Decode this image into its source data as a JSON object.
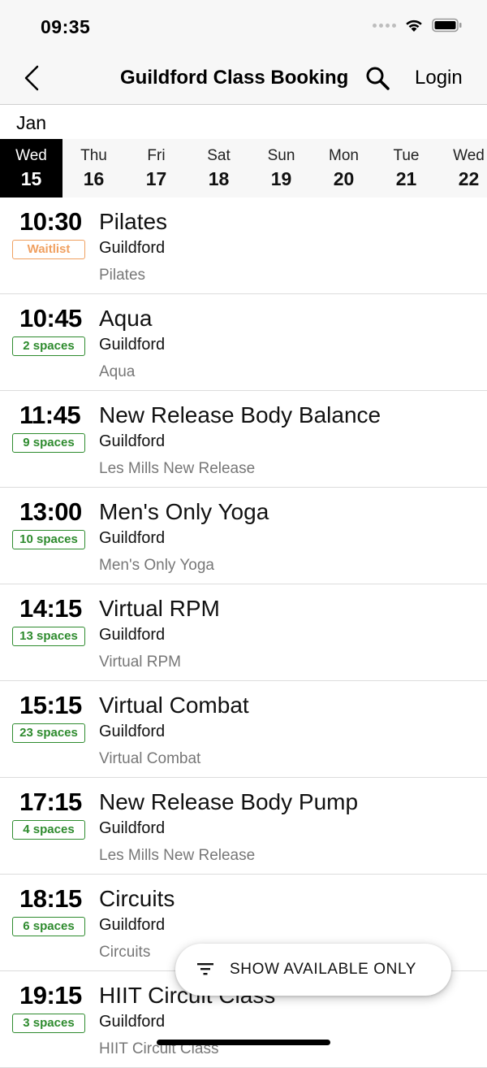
{
  "status_bar": {
    "time": "09:35"
  },
  "nav": {
    "title": "Guildford Class Booking",
    "login_label": "Login"
  },
  "month": "Jan",
  "days": [
    {
      "dow": "Wed",
      "dom": "15",
      "selected": true
    },
    {
      "dow": "Thu",
      "dom": "16"
    },
    {
      "dow": "Fri",
      "dom": "17"
    },
    {
      "dow": "Sat",
      "dom": "18"
    },
    {
      "dow": "Sun",
      "dom": "19"
    },
    {
      "dow": "Mon",
      "dom": "20"
    },
    {
      "dow": "Tue",
      "dom": "21"
    },
    {
      "dow": "Wed",
      "dom": "22"
    }
  ],
  "classes": [
    {
      "time": "10:30",
      "badge": "Waitlist",
      "status": "waitlist",
      "name": "Pilates",
      "location": "Guildford",
      "category": "Pilates"
    },
    {
      "time": "10:45",
      "badge": "2 spaces",
      "status": "available",
      "name": "Aqua",
      "location": "Guildford",
      "category": "Aqua"
    },
    {
      "time": "11:45",
      "badge": "9 spaces",
      "status": "available",
      "name": "New Release Body Balance",
      "location": "Guildford",
      "category": "Les Mills New Release"
    },
    {
      "time": "13:00",
      "badge": "10 spaces",
      "status": "available",
      "name": "Men's Only Yoga",
      "location": "Guildford",
      "category": "Men's Only Yoga"
    },
    {
      "time": "14:15",
      "badge": "13 spaces",
      "status": "available",
      "name": "Virtual RPM",
      "location": "Guildford",
      "category": "Virtual RPM"
    },
    {
      "time": "15:15",
      "badge": "23 spaces",
      "status": "available",
      "name": "Virtual Combat",
      "location": "Guildford",
      "category": "Virtual Combat"
    },
    {
      "time": "17:15",
      "badge": "4 spaces",
      "status": "available",
      "name": "New Release Body Pump",
      "location": "Guildford",
      "category": "Les Mills New Release"
    },
    {
      "time": "18:15",
      "badge": "6 spaces",
      "status": "available",
      "name": "Circuits",
      "location": "Guildford",
      "category": "Circuits"
    },
    {
      "time": "19:15",
      "badge": "3 spaces",
      "status": "available",
      "name": "HIIT Circuit Class",
      "location": "Guildford",
      "category": "HIIT Circuit Class"
    }
  ],
  "filter_button": {
    "label": "SHOW AVAILABLE ONLY",
    "icon": "filter-icon"
  },
  "colors": {
    "available": "#2e8b2e",
    "waitlist": "#f0a060",
    "selected_day_bg": "#000000"
  }
}
